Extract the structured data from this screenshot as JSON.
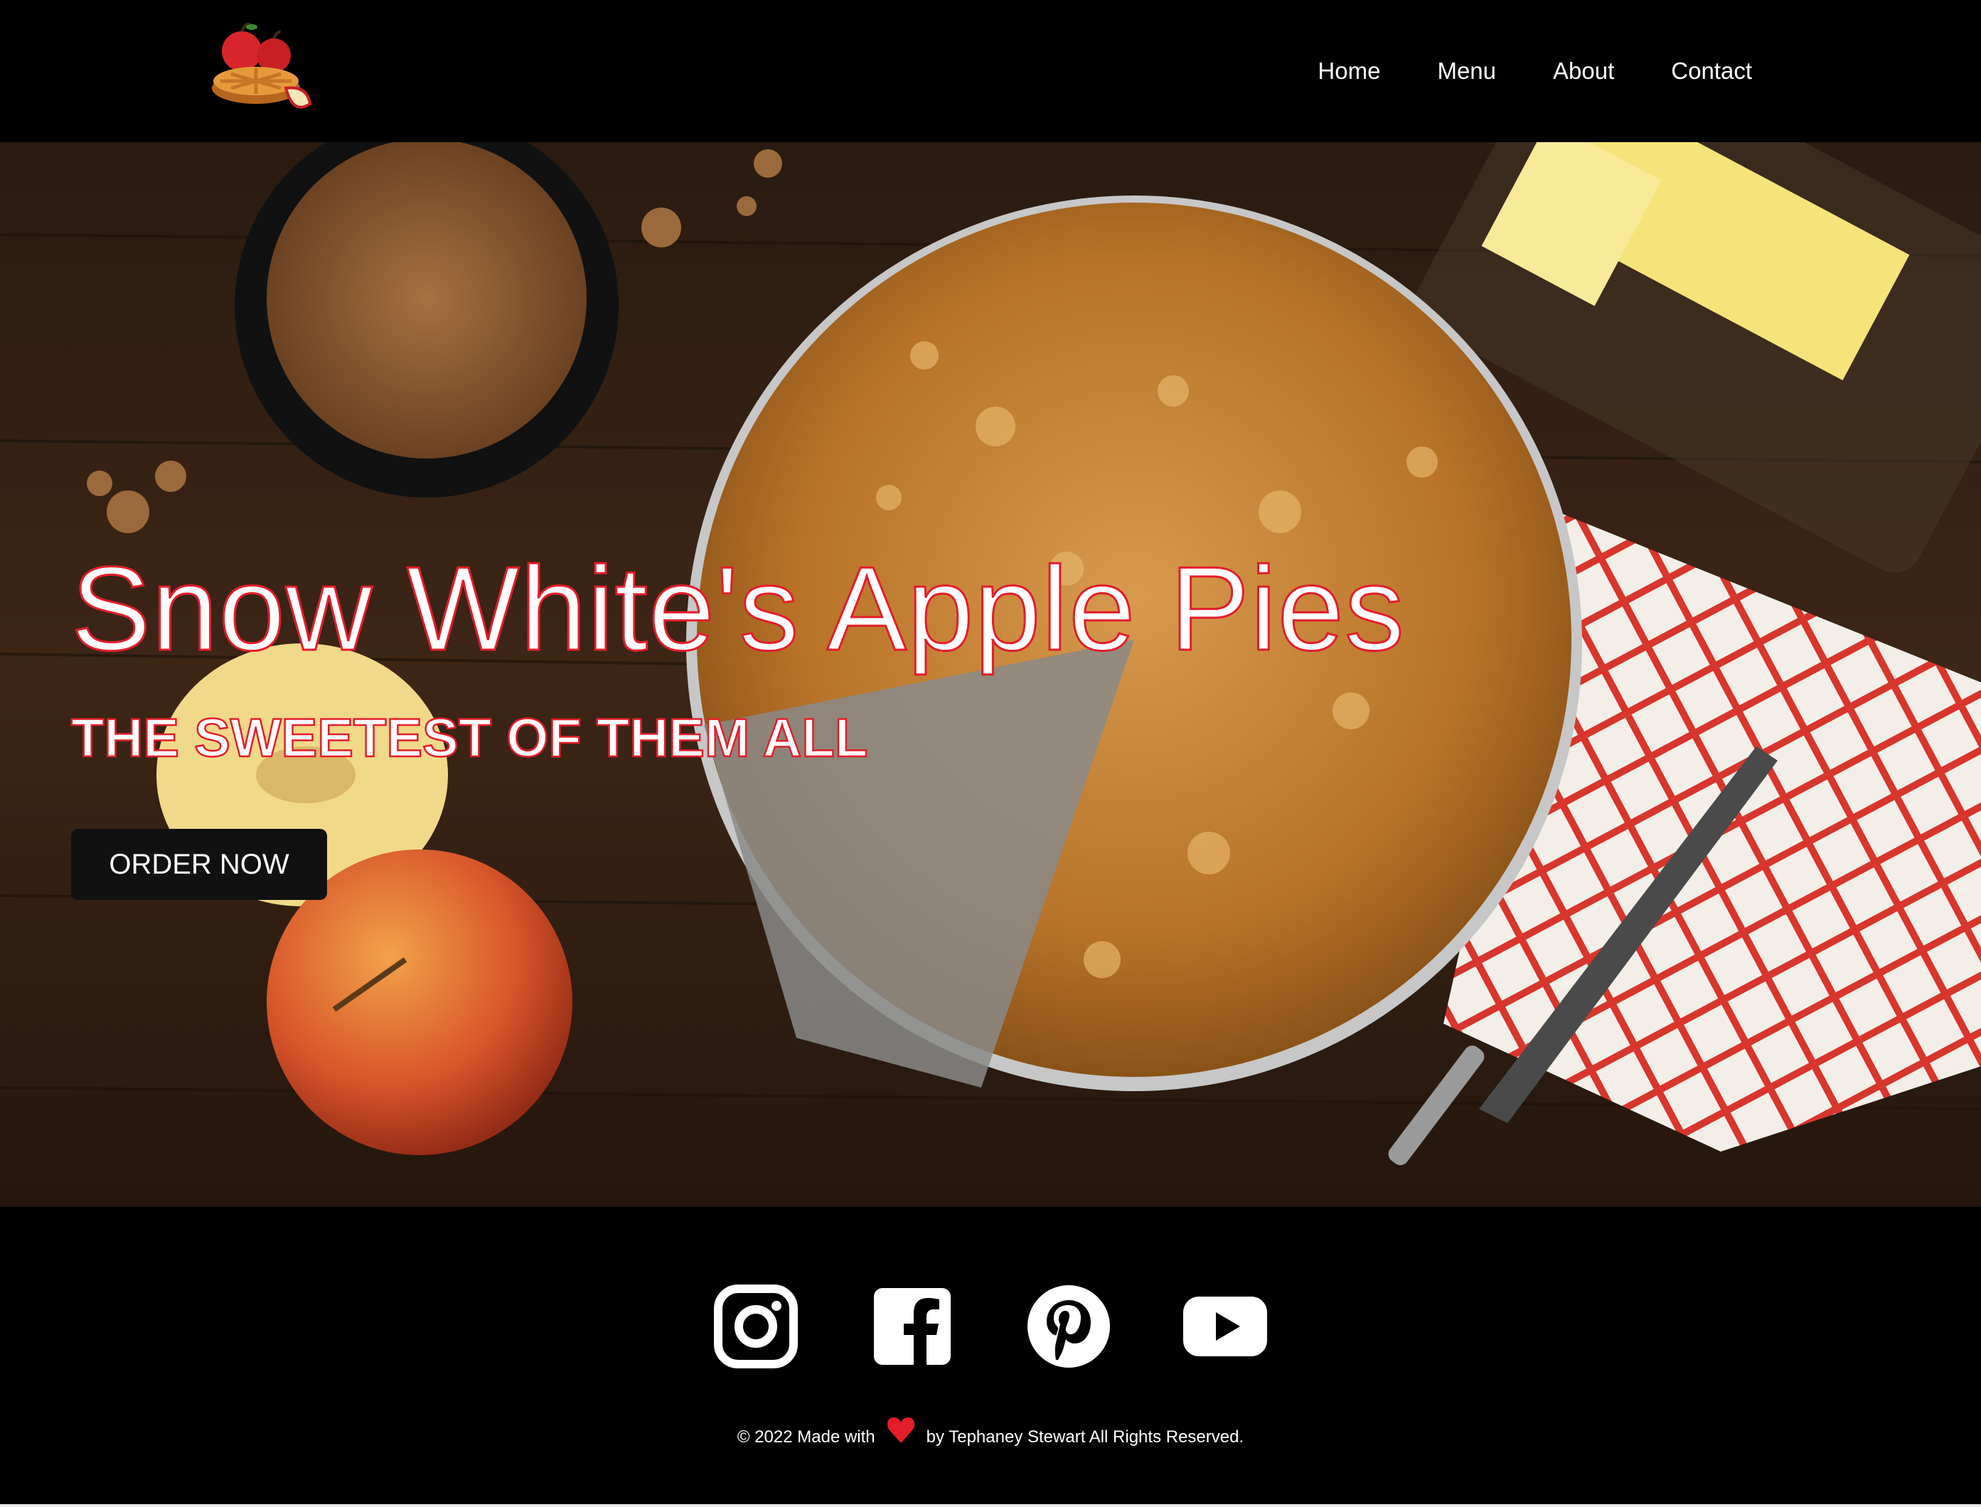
{
  "header": {
    "logo_alt": "apple pie logo",
    "nav": [
      {
        "label": "Home"
      },
      {
        "label": "Menu"
      },
      {
        "label": "About"
      },
      {
        "label": "Contact"
      }
    ]
  },
  "hero": {
    "title": "Snow White's Apple Pies",
    "subtitle": "THE SWEETEST OF THEM ALL",
    "cta_label": "ORDER NOW",
    "accent_color": "#e41d2b"
  },
  "footer": {
    "social": [
      {
        "icon": "instagram-icon"
      },
      {
        "icon": "facebook-icon"
      },
      {
        "icon": "pinterest-icon"
      },
      {
        "icon": "youtube-icon"
      }
    ],
    "copyright_prefix": "© 2022 Made with",
    "copyright_suffix": "by Tephaney Stewart All Rights Reserved.",
    "heart_color": "#e41d2b"
  }
}
